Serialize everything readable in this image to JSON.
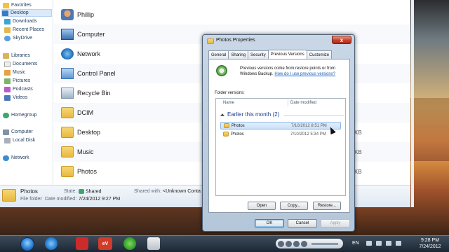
{
  "nav": {
    "items": [
      {
        "label": "Favorites",
        "icon": "star-icon"
      },
      {
        "label": "Desktop",
        "icon": "desktop-icon"
      },
      {
        "label": "Downloads",
        "icon": "downloads-icon"
      },
      {
        "label": "Recent Places",
        "icon": "recent-places-icon"
      },
      {
        "label": "SkyDrive",
        "icon": "skydrive-icon"
      },
      {
        "label": "Libraries",
        "icon": "libraries-icon"
      },
      {
        "label": "Documents",
        "icon": "documents-icon"
      },
      {
        "label": "Music",
        "icon": "music-icon"
      },
      {
        "label": "Pictures",
        "icon": "pictures-icon"
      },
      {
        "label": "Podcasts",
        "icon": "podcasts-icon"
      },
      {
        "label": "Videos",
        "icon": "videos-icon"
      },
      {
        "label": "Homegroup",
        "icon": "homegroup-icon"
      },
      {
        "label": "Computer",
        "icon": "computer-icon"
      },
      {
        "label": "Local Disk",
        "icon": "local-disk-icon"
      },
      {
        "label": "Network",
        "icon": "network-icon"
      }
    ]
  },
  "content": {
    "items": [
      {
        "label": "Phillip",
        "icon": "user-folder-icon"
      },
      {
        "label": "Computer",
        "icon": "computer-icon"
      },
      {
        "label": "Network",
        "icon": "network-globe-icon"
      },
      {
        "label": "Control Panel",
        "icon": "control-panel-icon"
      },
      {
        "label": "Recycle Bin",
        "icon": "recycle-bin-icon"
      },
      {
        "label": "DCIM",
        "icon": "folder-icon"
      },
      {
        "label": "Desktop",
        "icon": "folder-icon"
      },
      {
        "label": "Music",
        "icon": "folder-icon"
      },
      {
        "label": "Photos",
        "icon": "folder-icon"
      }
    ],
    "size_tails": [
      "KB",
      "KB",
      "KB"
    ]
  },
  "details": {
    "name": "Photos",
    "type": "File folder",
    "state_label": "State:",
    "state_value": "Shared",
    "shared_with_label": "Shared with:",
    "shared_with_value": "<Unknown Conta",
    "date_modified_label": "Date modified:",
    "date_modified_value": "7/24/2012 9:27 PM"
  },
  "dialog": {
    "title": "Photos Properties",
    "close_label": "x",
    "tabs": [
      "General",
      "Sharing",
      "Security",
      "Previous Versions",
      "Customize"
    ],
    "active_tab": "Previous Versions",
    "description": "Previous versions come from restore points or from Windows Backup.",
    "help_link": "How do I use previous versions?",
    "folder_versions_label": "Folder versions:",
    "columns": {
      "name": "Name",
      "date": "Date modified"
    },
    "group_label": "Earlier this month (2)",
    "versions": [
      {
        "name": "Photos",
        "date": "7/10/2012 8:51 PM",
        "selected": true
      },
      {
        "name": "Photos",
        "date": "7/10/2012 5:34 PM",
        "selected": false
      }
    ],
    "buttons": {
      "open": "Open",
      "copy": "Copy...",
      "restore": "Restore...",
      "ok": "OK",
      "cancel": "Cancel",
      "apply": "Apply"
    }
  },
  "taskbar": {
    "ev_label": "eV",
    "language": "EN",
    "time": "9:28 PM",
    "date": "7/24/2012"
  }
}
